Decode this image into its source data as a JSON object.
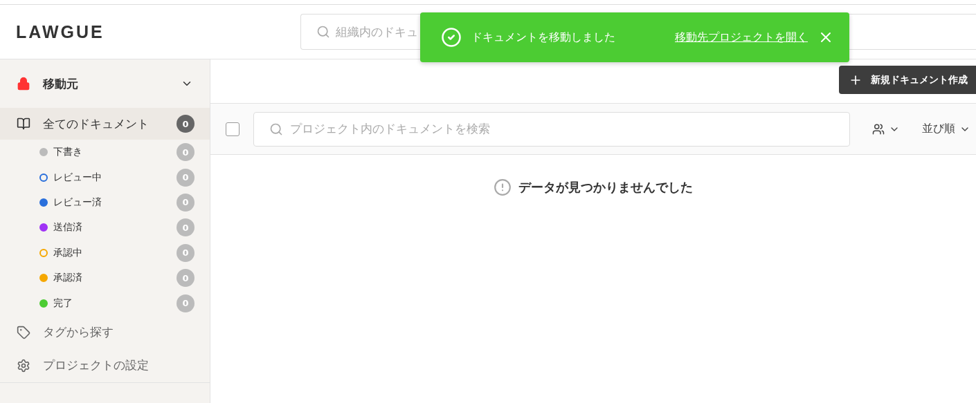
{
  "header": {
    "logo": "LAWGUE",
    "search": {
      "placeholder": "組織内のドキュ"
    }
  },
  "toast": {
    "message": "ドキュメントを移動しました",
    "link": "移動先プロジェクトを開く"
  },
  "sidebar": {
    "section": {
      "label": "移動元",
      "expanded": true
    },
    "items": [
      {
        "label": "全てのドキュメント",
        "count": "0",
        "selected": true,
        "children": [
          {
            "label": "下書き",
            "count": "0",
            "kind": "filled",
            "color": "#bbbbbb"
          },
          {
            "label": "レビュー中",
            "count": "0",
            "kind": "hollow",
            "color": "#2a6fdb"
          },
          {
            "label": "レビュー済",
            "count": "0",
            "kind": "filled",
            "color": "#2a6fdb"
          },
          {
            "label": "送信済",
            "count": "0",
            "kind": "filled",
            "color": "#a033f5"
          },
          {
            "label": "承認中",
            "count": "0",
            "kind": "hollow",
            "color": "#f5a700"
          },
          {
            "label": "承認済",
            "count": "0",
            "kind": "filled",
            "color": "#f5a700"
          },
          {
            "label": "完了",
            "count": "0",
            "kind": "filled",
            "color": "#4ccc33"
          }
        ]
      }
    ],
    "links": [
      {
        "label": "タグから探す",
        "kind": "tag"
      },
      {
        "label": "プロジェクトの設定",
        "kind": "settings"
      }
    ]
  },
  "main": {
    "new_button": "新規ドキュメント作成",
    "select_all": {
      "checked": false
    },
    "search": {
      "placeholder": "プロジェクト内のドキュメントを検索"
    },
    "sort": "並び順",
    "empty": "データが見つかりませんでした"
  }
}
